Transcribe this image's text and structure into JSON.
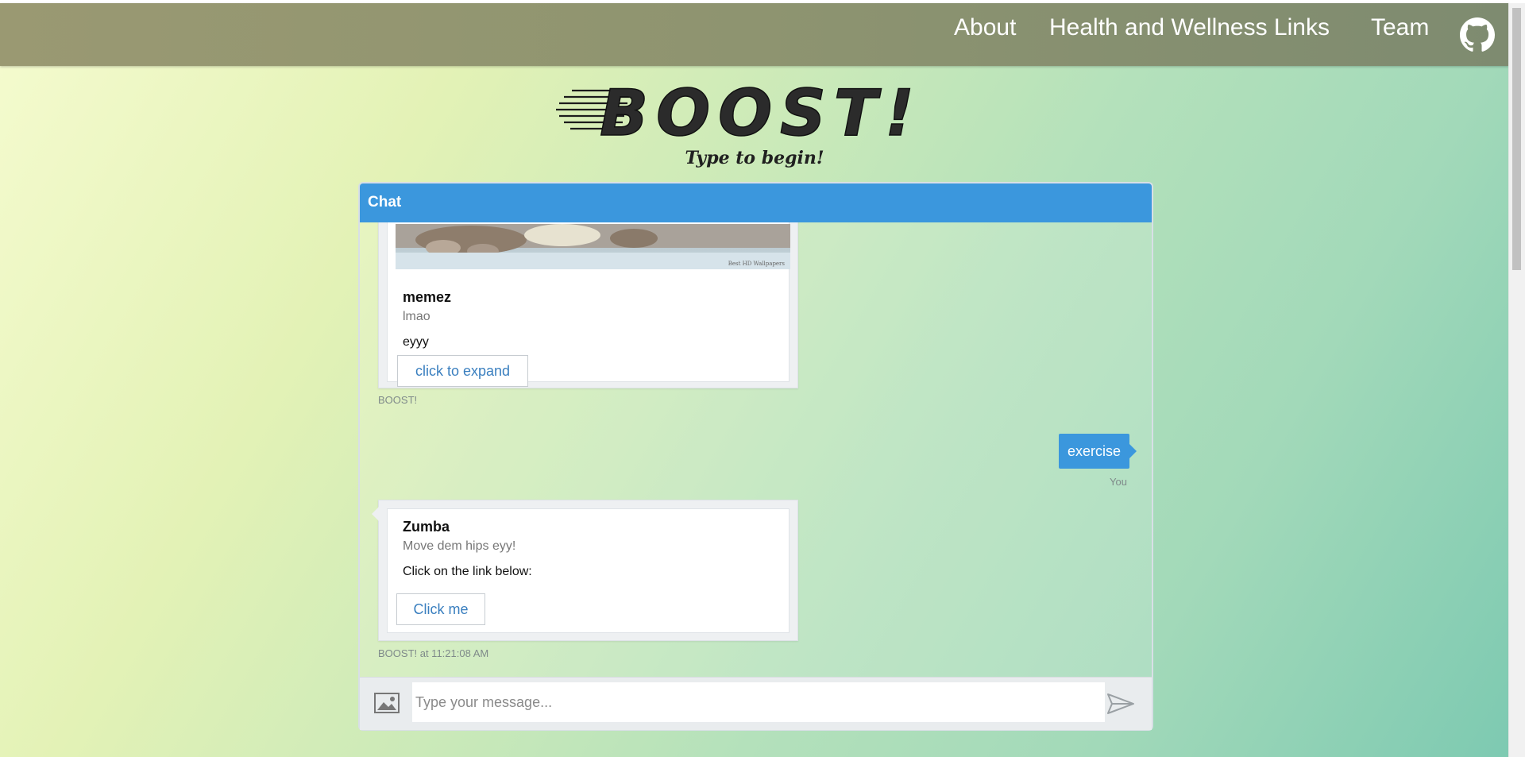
{
  "nav": {
    "items": [
      {
        "label": "About"
      },
      {
        "label": "Health and Wellness Links"
      },
      {
        "label": "Team"
      }
    ],
    "github_icon": "github-icon"
  },
  "header": {
    "logo_text": "BOOST!",
    "subtitle": "Type to begin!"
  },
  "chat": {
    "title": "Chat",
    "messages": [
      {
        "type": "card",
        "image_caption": "Best HD Wallpapers",
        "title": "memez",
        "subtitle": "lmao",
        "text": "eyyy",
        "button": "click to expand",
        "meta": "BOOST!"
      },
      {
        "type": "user",
        "text": "exercise",
        "meta": "You"
      },
      {
        "type": "card",
        "title": "Zumba",
        "subtitle": "Move dem hips eyy!",
        "text": "Click on the link below:",
        "button": "Click me",
        "meta": "BOOST! at 11:21:08 AM"
      }
    ],
    "input": {
      "placeholder": "Type your message...",
      "value": ""
    },
    "icons": {
      "attach": "image-icon",
      "send": "send-icon"
    }
  },
  "colors": {
    "accent": "#3b97dd",
    "navbar": "#8e9470",
    "link": "#3a7fbf"
  }
}
